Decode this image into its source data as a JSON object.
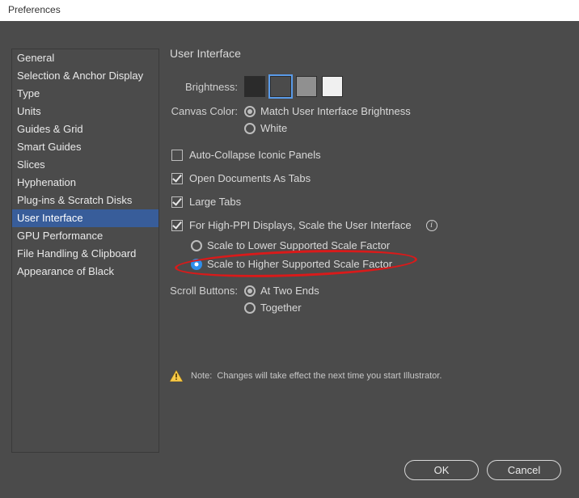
{
  "window": {
    "title": "Preferences"
  },
  "sidebar": {
    "items": [
      {
        "label": "General"
      },
      {
        "label": "Selection & Anchor Display"
      },
      {
        "label": "Type"
      },
      {
        "label": "Units"
      },
      {
        "label": "Guides & Grid"
      },
      {
        "label": "Smart Guides"
      },
      {
        "label": "Slices"
      },
      {
        "label": "Hyphenation"
      },
      {
        "label": "Plug-ins & Scratch Disks"
      },
      {
        "label": "User Interface",
        "selected": true
      },
      {
        "label": "GPU Performance"
      },
      {
        "label": "File Handling & Clipboard"
      },
      {
        "label": "Appearance of Black"
      }
    ]
  },
  "panel": {
    "title": "User Interface",
    "brightness_label": "Brightness:",
    "brightness_swatches": [
      {
        "color": "#2b2b2b",
        "selected": false
      },
      {
        "color": "#4b4b4b",
        "selected": true
      },
      {
        "color": "#909090",
        "selected": false
      },
      {
        "color": "#f0f0f0",
        "selected": false
      }
    ],
    "canvas_color_label": "Canvas Color:",
    "canvas_color_options": [
      {
        "label": "Match User Interface Brightness",
        "checked": true
      },
      {
        "label": "White",
        "checked": false
      }
    ],
    "checkboxes": [
      {
        "label": "Auto-Collapse Iconic Panels",
        "checked": false
      },
      {
        "label": "Open Documents As Tabs",
        "checked": true
      },
      {
        "label": "Large Tabs",
        "checked": true
      },
      {
        "label": "For High-PPI Displays, Scale the User Interface",
        "checked": true,
        "info": true
      }
    ],
    "scale_options": [
      {
        "label": "Scale to Lower Supported Scale Factor",
        "checked": false
      },
      {
        "label": "Scale to Higher Supported Scale Factor",
        "checked": true,
        "highlighted": true
      }
    ],
    "scroll_label": "Scroll Buttons:",
    "scroll_options": [
      {
        "label": "At Two Ends",
        "checked": true
      },
      {
        "label": "Together",
        "checked": false
      }
    ],
    "note_prefix": "Note:",
    "note_text": "Changes will take effect the next time you start Illustrator."
  },
  "buttons": {
    "ok": "OK",
    "cancel": "Cancel"
  }
}
